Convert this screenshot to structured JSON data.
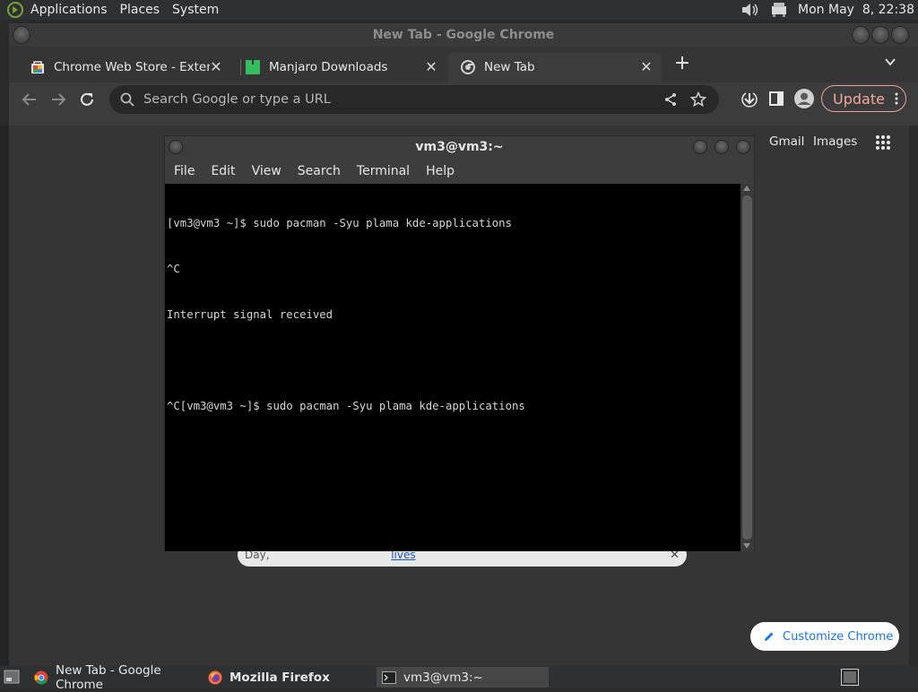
{
  "top_panel": {
    "menus": [
      "Applications",
      "Places",
      "System"
    ],
    "clock": "Mon May  8, 22:38"
  },
  "chrome": {
    "window_title": "New Tab - Google Chrome",
    "tabs": [
      {
        "label": "Chrome Web Store - Extension"
      },
      {
        "label": "Manjaro Downloads"
      },
      {
        "label": "New Tab"
      }
    ],
    "omnibox_placeholder": "Search Google or type a URL",
    "update_label": "Update"
  },
  "ntp": {
    "gmail": "Gmail",
    "images": "Images",
    "promo_text": "On Fentanyl Awareness Day,",
    "promo_link": "learn about the hidden dangers and how to help save lives",
    "customize_label": "Customize Chrome"
  },
  "terminal": {
    "title": "vm3@vm3:~",
    "menu": [
      "File",
      "Edit",
      "View",
      "Search",
      "Terminal",
      "Help"
    ],
    "lines": [
      "[vm3@vm3 ~]$ sudo pacman -Syu plama kde-applications",
      "^C",
      "Interrupt signal received",
      "",
      "^C[vm3@vm3 ~]$ sudo pacman -Syu plama kde-applications"
    ]
  },
  "taskbar": {
    "tasks": [
      {
        "label": "New Tab - Google Chrome"
      },
      {
        "label": "Mozilla Firefox"
      },
      {
        "label": "vm3@vm3:~"
      }
    ]
  },
  "colors": {
    "accent_update": "#f2a79f",
    "customize_text": "#1a73e8",
    "terminal_bg": "#000000"
  }
}
